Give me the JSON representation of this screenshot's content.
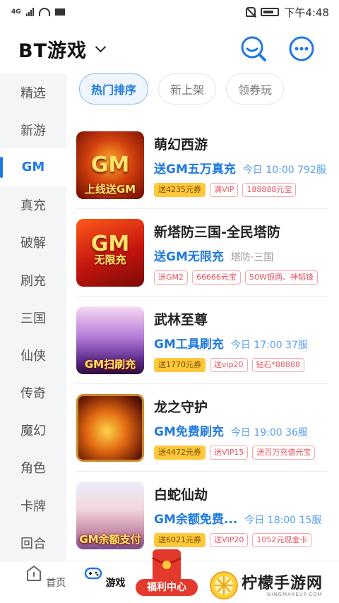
{
  "status": {
    "network": "4G",
    "time": "下午4:48"
  },
  "header": {
    "title": "BT游戏"
  },
  "sidebar": {
    "items": [
      "精选",
      "新游",
      "GM",
      "真充",
      "破解",
      "刷充",
      "三国",
      "仙侠",
      "传奇",
      "魔幻",
      "角色",
      "卡牌",
      "回合"
    ],
    "active_index": 2
  },
  "tabs": [
    {
      "label": "热门排序"
    },
    {
      "label": "新上架"
    },
    {
      "label": "领券玩"
    }
  ],
  "games": [
    {
      "name": "萌幻西游",
      "promo": "送GM五万真充",
      "meta": "今日 10:00 792服",
      "thumb_text": "上线送GM",
      "thumb_gm": "GM",
      "badges": [
        "送4235元券",
        "满VIP",
        "188888元宝"
      ]
    },
    {
      "name": "新塔防三国-全民塔防",
      "promo": "送GM无限充",
      "meta": "塔防·三国",
      "thumb_text": "无限充",
      "thumb_gm": "GM",
      "badges": [
        "送GM2",
        "66666元宝",
        "50W银两、神韬锋"
      ]
    },
    {
      "name": "武林至尊",
      "promo": "GM工具刷充",
      "meta": "今日 17:00 37服",
      "thumb_text": "GM扫刷充",
      "thumb_gm": "",
      "badges": [
        "送1770元券",
        "送vip20",
        "钻石*88888"
      ]
    },
    {
      "name": "龙之守护",
      "promo": "GM免费刷充",
      "meta": "今日 19:00 36服",
      "thumb_text": "",
      "thumb_gm": "",
      "badges": [
        "送4472元券",
        "送VIP15",
        "送百万充值元宝"
      ]
    },
    {
      "name": "白蛇仙劫",
      "promo": "GM余额免费...",
      "meta": "今日 18:00 15服",
      "thumb_text": "GM余额支付",
      "thumb_gm": "",
      "badges": [
        "送6021元券",
        "送VIP20",
        "1052元现金卡"
      ]
    }
  ],
  "bottom_nav": {
    "home": "首页",
    "games": "游戏",
    "welfare": "福利中心"
  },
  "watermark": {
    "text": "柠檬手游网",
    "sub": "NINGMAKEUP.COM"
  },
  "colors": {
    "accent": "#1f7ae0",
    "badge_gold": "#ffc83a",
    "badge_red": "#e85561"
  }
}
